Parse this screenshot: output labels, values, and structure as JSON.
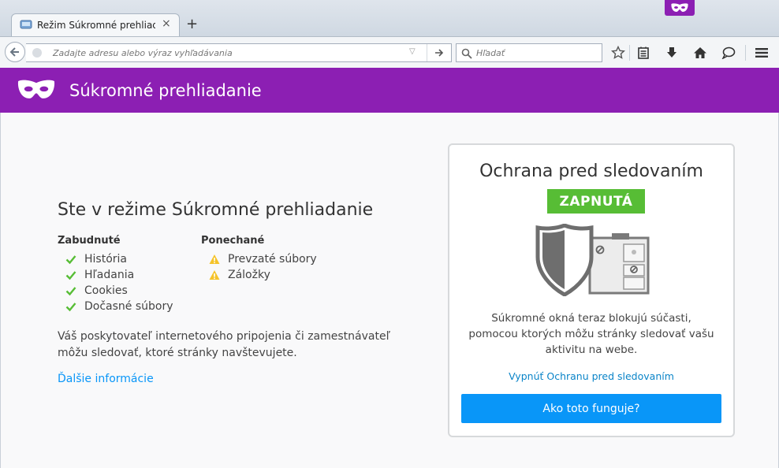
{
  "tab": {
    "title": "Režim Súkromné prehliada...",
    "close": "×",
    "new_tab": "+"
  },
  "navbar": {
    "url_placeholder": "Zadajte adresu alebo výraz vyhľadávania",
    "search_placeholder": "Hľadať"
  },
  "header": {
    "title": "Súkromné prehliadanie"
  },
  "main": {
    "title": "Ste v režime Súkromné prehliadanie",
    "forgotten": {
      "heading": "Zabudnuté",
      "items": [
        "História",
        "Hľadania",
        "Cookies",
        "Dočasné súbory"
      ]
    },
    "kept": {
      "heading": "Ponechané",
      "items": [
        "Prevzaté súbory",
        "Záložky"
      ]
    },
    "disclaimer": "Váš poskytovateľ internetového pripojenia či zamestnávateľ môžu sledovať, ktoré stránky navštevujete.",
    "learn_more": "Ďalšie informácie"
  },
  "tracking": {
    "title": "Ochrana pred sledovaním",
    "status": "ZAPNUTÁ",
    "description": "Súkromné okná teraz blokujú súčasti, pomocou ktorých môžu stránky sledovať vašu aktivitu na webe.",
    "toggle_link": "Vypnúť Ochranu pred sledovaním",
    "howto_button": "Ako toto funguje?"
  },
  "colors": {
    "private_purple": "#8c1fb3",
    "status_green": "#57bd35",
    "link_blue": "#0996f8",
    "check_green": "#57bd35",
    "warning_yellow": "#f5c32a"
  },
  "icons": [
    "private-mask-icon",
    "back-icon",
    "globe-icon",
    "go-arrow-icon",
    "search-icon",
    "bookmark-star-icon",
    "reading-list-icon",
    "download-icon",
    "home-icon",
    "chat-icon",
    "hamburger-menu-icon",
    "check-icon",
    "warning-icon",
    "shield-icon"
  ]
}
